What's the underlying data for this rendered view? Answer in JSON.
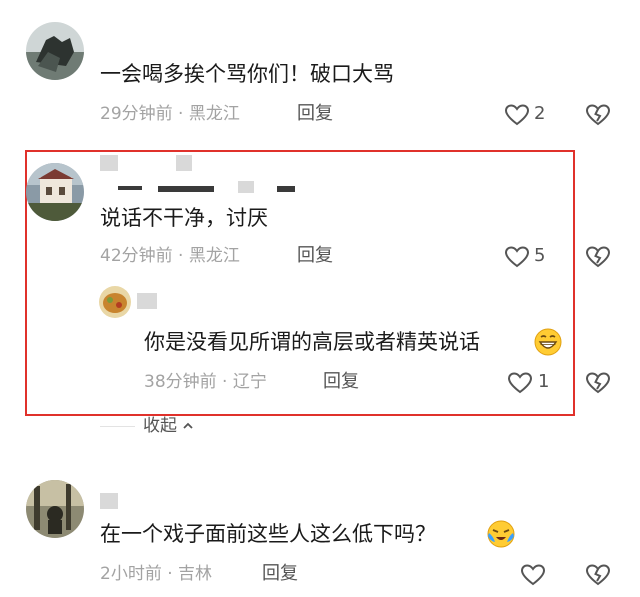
{
  "comments": [
    {
      "text": "一会喝多挨个骂你们！破口大骂",
      "time": "29分钟前",
      "location": "黑龙江",
      "reply_label": "回复",
      "likes": "2"
    },
    {
      "text": "说话不干净，讨厌",
      "time": "42分钟前",
      "location": "黑龙江",
      "reply_label": "回复",
      "likes": "5",
      "replies": [
        {
          "text": "你是没看见所谓的高层或者精英说话",
          "emoji": "grinning-face-icon",
          "time": "38分钟前",
          "location": "辽宁",
          "reply_label": "回复",
          "likes": "1"
        }
      ],
      "collapse_label": "收起"
    },
    {
      "text": "在一个戏子面前这些人这么低下吗？",
      "emoji": "crying-face-icon",
      "time": "2小时前",
      "location": "吉林",
      "reply_label": "回复",
      "likes": ""
    }
  ],
  "separator": " · ",
  "highlight_color": "#e0312b"
}
